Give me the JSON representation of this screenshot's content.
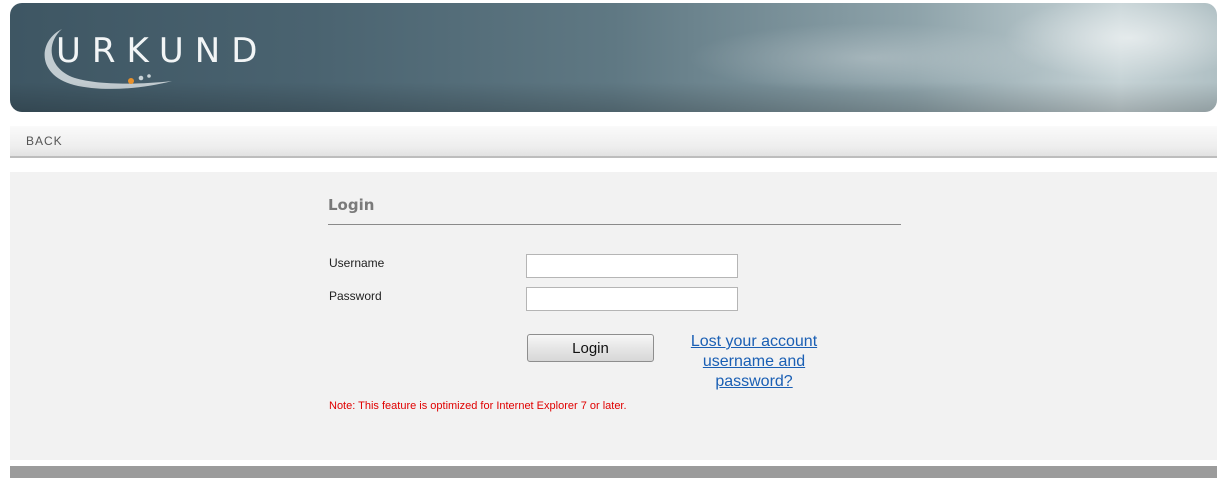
{
  "header": {
    "logo_text": "URKUND"
  },
  "nav": {
    "back_label": "BACK"
  },
  "login": {
    "title": "Login",
    "username_label": "Username",
    "username_value": "",
    "password_label": "Password",
    "password_value": "",
    "submit_label": "Login",
    "lost_link_label": "Lost your account username and password?",
    "note": "Note: This feature is optimized for Internet Explorer 7 or later."
  },
  "colors": {
    "note_red": "#e00000",
    "link_blue": "#1a5fb4",
    "logo_dot_orange": "#e8912a"
  }
}
